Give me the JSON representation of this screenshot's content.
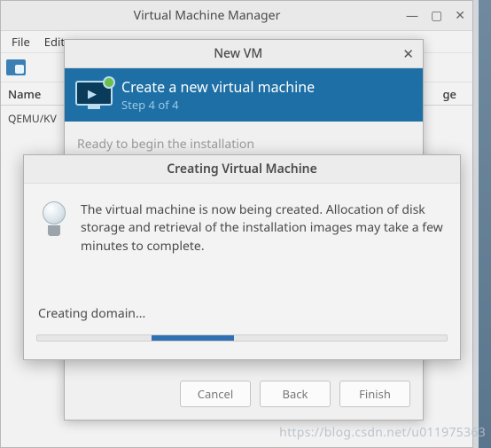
{
  "main_window": {
    "title": "Virtual Machine Manager",
    "menu": {
      "file": "File",
      "edit": "Edit"
    },
    "columns": {
      "name": "Name",
      "usage": "ge"
    },
    "rows": [
      "QEMU/KV"
    ]
  },
  "new_vm_dialog": {
    "title": "New VM",
    "banner_title": "Create a new virtual machine",
    "banner_step": "Step 4 of 4",
    "body_text": "Ready to begin the installation",
    "buttons": {
      "cancel": "Cancel",
      "back": "Back",
      "finish": "Finish"
    }
  },
  "progress_dialog": {
    "title": "Creating Virtual Machine",
    "message": "The virtual machine is now being created. Allocation of disk storage and retrieval of the installation images may take a few minutes to complete.",
    "status": "Creating domain..."
  },
  "watermark": "https://blog.csdn.net/u011975363"
}
